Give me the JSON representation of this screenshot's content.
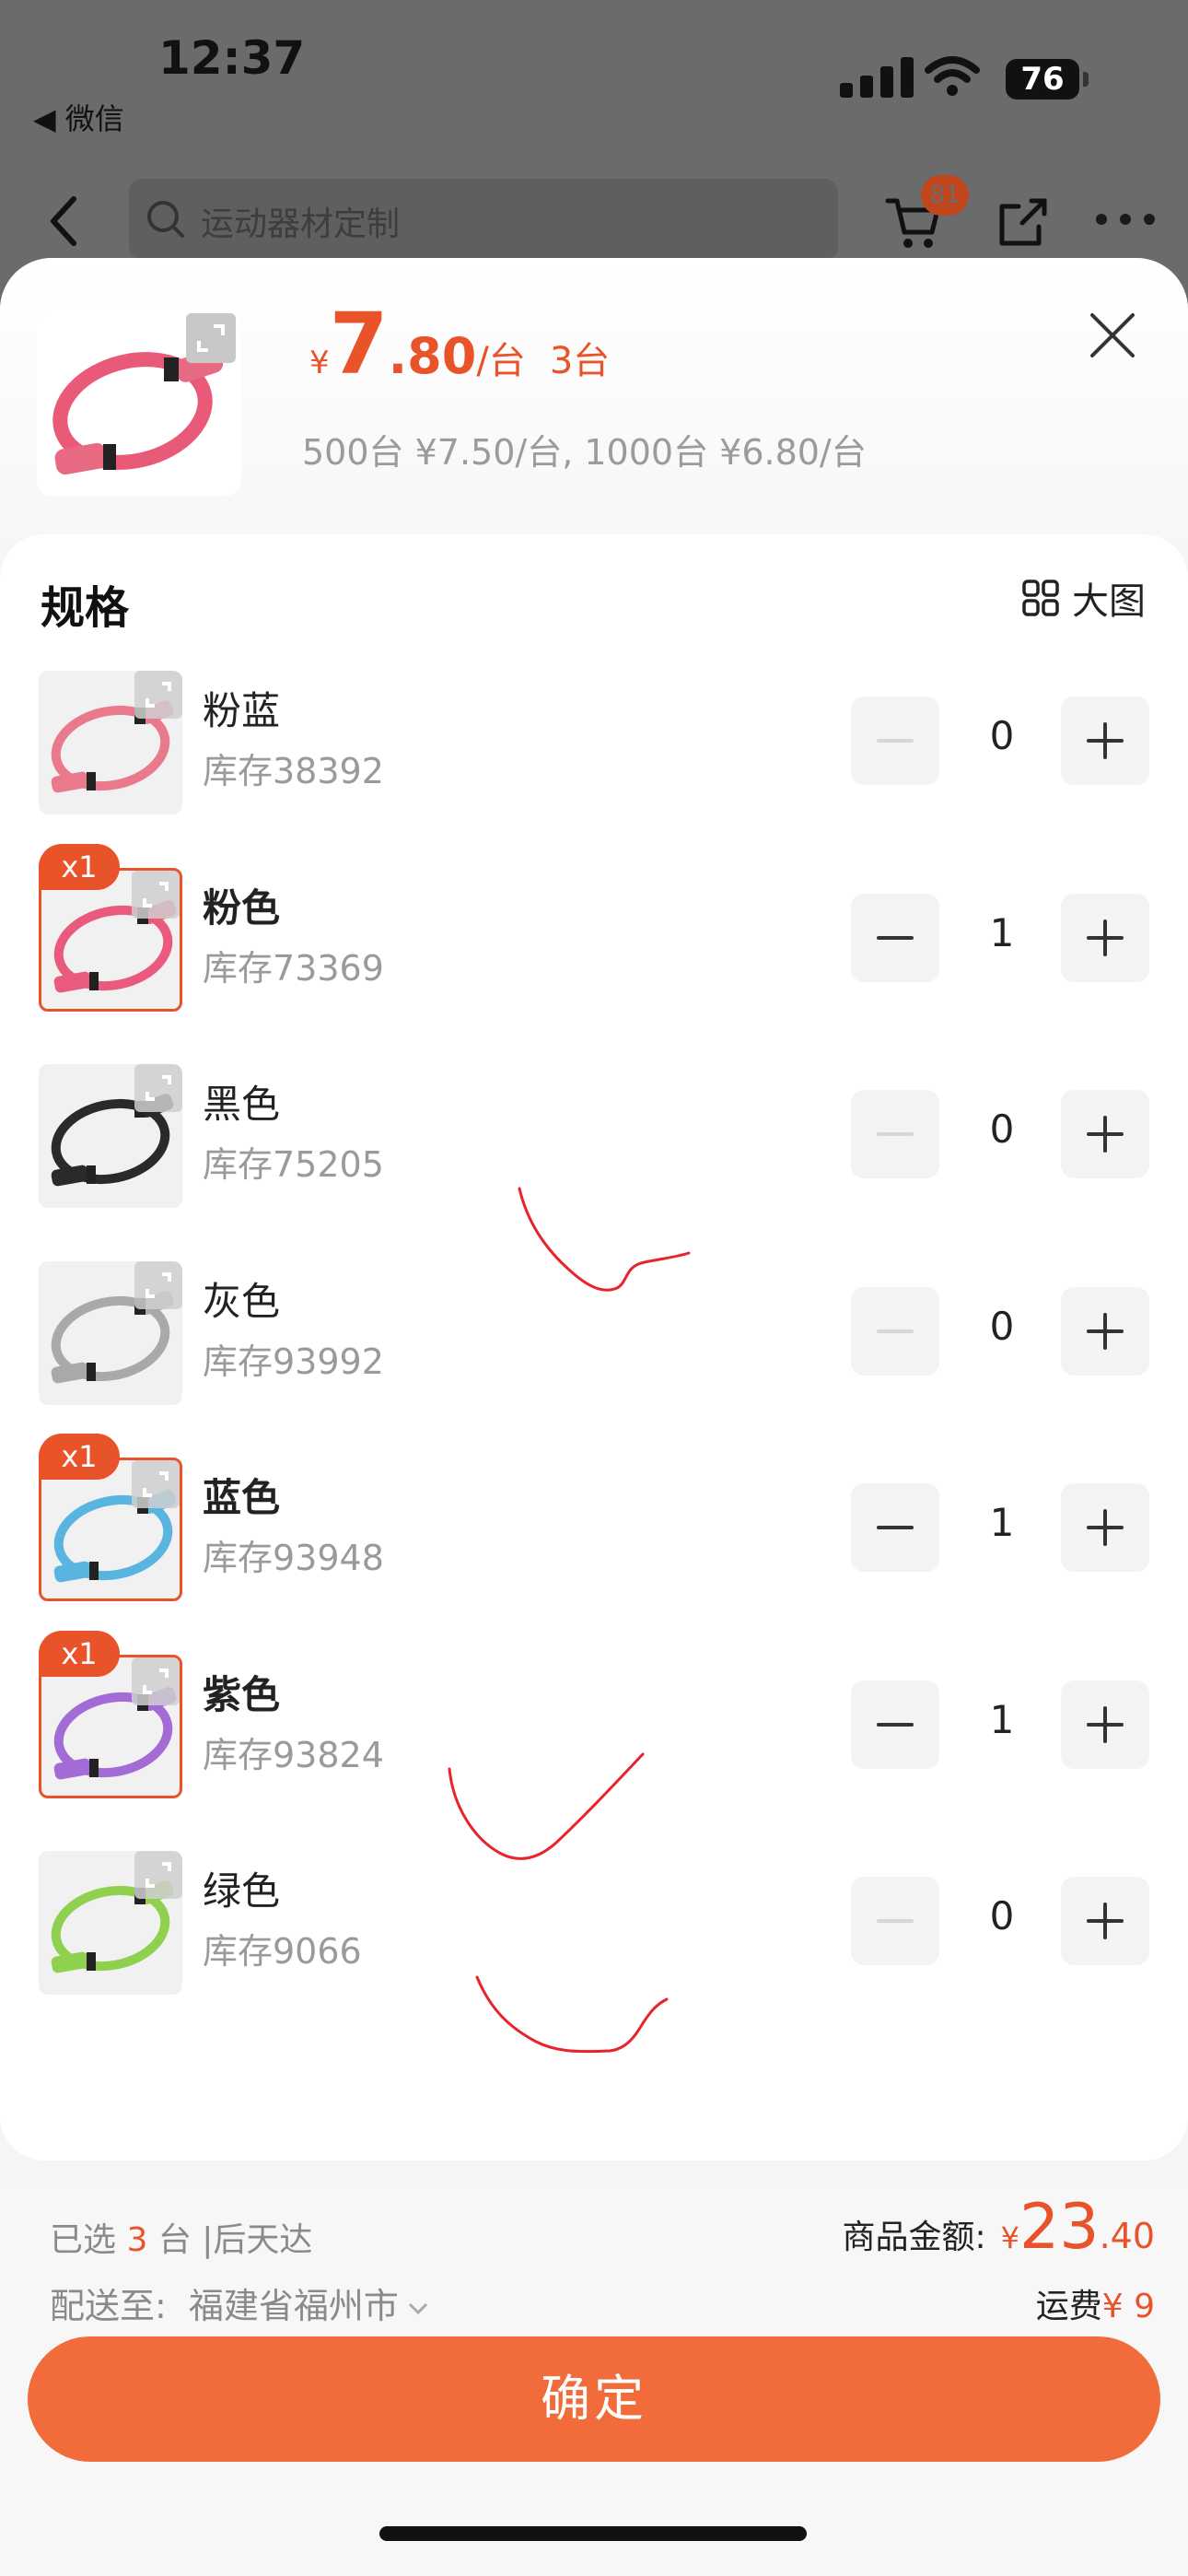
{
  "status": {
    "time": "12:37",
    "back_app": "◀ 微信",
    "battery": "76"
  },
  "nav": {
    "search_placeholder": "运动器材定制",
    "cart_count": "81"
  },
  "header": {
    "price_yen": "¥",
    "price_int": "7",
    "price_dec": ".80",
    "price_unit": "/台",
    "quantity": "3台",
    "tier_pricing": "500台 ¥7.50/台, 1000台 ¥6.80/台"
  },
  "spec": {
    "title": "规格",
    "big_view_label": "大图",
    "items": [
      {
        "name": "粉蓝",
        "stock": "库存38392",
        "count": "0",
        "selected": false,
        "color": "#e97a8c"
      },
      {
        "name": "粉色",
        "stock": "库存73369",
        "count": "1",
        "selected": true,
        "badge": "x1",
        "color": "#ea5a7c"
      },
      {
        "name": "黑色",
        "stock": "库存75205",
        "count": "0",
        "selected": false,
        "color": "#2a2a2a"
      },
      {
        "name": "灰色",
        "stock": "库存93992",
        "count": "0",
        "selected": false,
        "color": "#a9a9a9"
      },
      {
        "name": "蓝色",
        "stock": "库存93948",
        "count": "1",
        "selected": true,
        "badge": "x1",
        "color": "#5ab4e0"
      },
      {
        "name": "紫色",
        "stock": "库存93824",
        "count": "1",
        "selected": true,
        "badge": "x1",
        "color": "#a26bd6"
      },
      {
        "name": "绿色",
        "stock": "库存9066",
        "count": "0",
        "selected": false,
        "color": "#8fd14f"
      }
    ]
  },
  "footer": {
    "selected_prefix": "已选",
    "selected_count": "3",
    "selected_suffix": "台 |后天达",
    "deliver_label": "配送至:",
    "deliver_city": "福建省福州市",
    "amount_label": "商品金额:",
    "amount_yen": "¥",
    "amount_int": "23",
    "amount_dec": ".40",
    "shipping_label": "运费",
    "shipping_fee": "¥ 9",
    "confirm_label": "确定"
  },
  "colors": {
    "accent": "#e8532a",
    "confirm_bg": "#f26b3a"
  }
}
